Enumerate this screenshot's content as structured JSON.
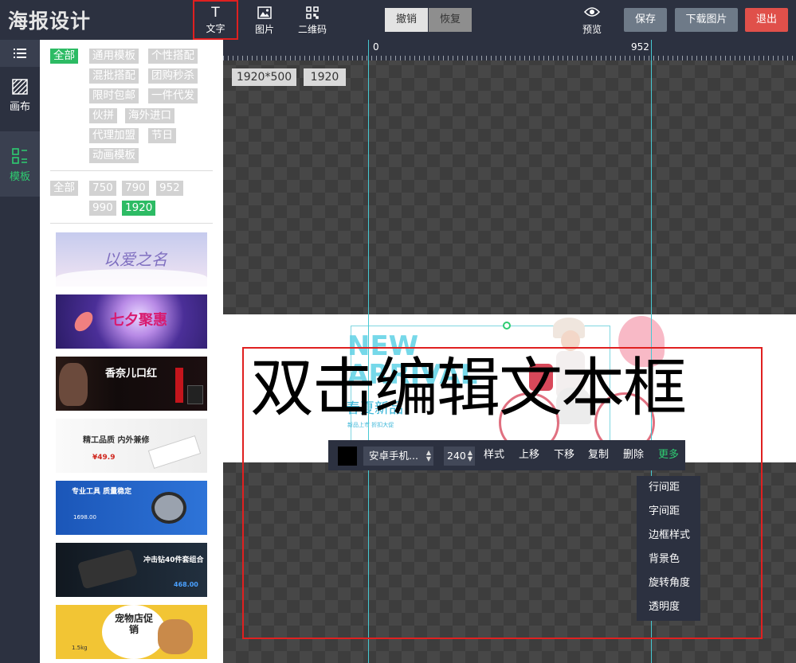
{
  "app": {
    "logo": "海报设计"
  },
  "toolbar": {
    "text": "文字",
    "image": "图片",
    "qrcode": "二维码",
    "undo": "撤销",
    "redo": "恢复",
    "preview": "预览",
    "save": "保存",
    "download": "下载图片",
    "exit": "退出"
  },
  "iconbar": {
    "canvas": "画布",
    "template": "模板"
  },
  "panel": {
    "categories": [
      "全部",
      "通用模板",
      "个性搭配",
      "混批搭配",
      "团购秒杀",
      "限时包邮",
      "一件代发",
      "伙拼",
      "海外进口",
      "代理加盟",
      "节日",
      "动画模板"
    ],
    "sizes": [
      "全部",
      "750",
      "790",
      "952",
      "990",
      "1920"
    ],
    "active_category": "全部",
    "active_size": "1920",
    "thumbs": [
      {
        "title": "以爱之名",
        "colors": [
          "#c9cdee",
          "#f5e6f3"
        ]
      },
      {
        "title": "七夕聚惠",
        "colors": [
          "#3e2c8a",
          "#9a5fd0"
        ]
      },
      {
        "title": "香奈儿口红",
        "colors": [
          "#1a0f10",
          "#5a1818"
        ]
      },
      {
        "title": "精工品质 内外兼修",
        "colors": [
          "#f4f4f4",
          "#e6e6e6"
        ]
      },
      {
        "title": "专业工具 质量稳定",
        "colors": [
          "#1c5fc1",
          "#3a82e6"
        ]
      },
      {
        "title": "冲击钻40件套组合",
        "colors": [
          "#0e1620",
          "#26364a"
        ]
      },
      {
        "title": "宠物店促销",
        "colors": [
          "#f2c534",
          "#ffe07a"
        ]
      }
    ],
    "thumb_texts": {
      "t4_price": "¥49.9",
      "t5_price": "1698.00",
      "t6_price": "468.00",
      "t7_weight": "1.5kg"
    }
  },
  "stage": {
    "ruler": {
      "start": "0",
      "end": "952"
    },
    "size_tags": [
      "1920*500",
      "1920"
    ],
    "banner": {
      "new": "NEW",
      "arrival": "ARRIVAL",
      "season": "春夏新品",
      "small": "新品上市 折扣大促"
    },
    "text_box": "双击编辑文本框"
  },
  "context_bar": {
    "font": "安卓手机...",
    "size": "240",
    "style": "样式",
    "up": "上移",
    "down": "下移",
    "copy": "复制",
    "delete": "删除",
    "more": "更多"
  },
  "more_menu": [
    "行间距",
    "字间距",
    "边框样式",
    "背景色",
    "旋转角度",
    "透明度"
  ],
  "colors": {
    "accent": "#2dbb64",
    "topbar": "#2c3140",
    "danger": "#e0504a",
    "guide": "#46c8d2"
  }
}
